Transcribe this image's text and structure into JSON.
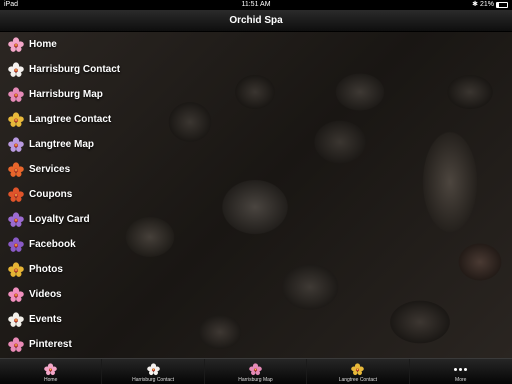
{
  "status_bar": {
    "device": "iPad",
    "time": "11:51 AM",
    "battery": "21%",
    "battery_level": 0.21
  },
  "nav": {
    "title": "Orchid Spa"
  },
  "menu": [
    {
      "label": "Home",
      "icon": "pink-orchid-icon",
      "color": "#f3a6c8"
    },
    {
      "label": "Harrisburg Contact",
      "icon": "white-orchid-icon",
      "color": "#f4f1ee"
    },
    {
      "label": "Harrisburg Map",
      "icon": "pink-orchid-icon",
      "color": "#e58ab7"
    },
    {
      "label": "Langtree Contact",
      "icon": "yellow-orchid-icon",
      "color": "#e8b93a"
    },
    {
      "label": "Langtree Map",
      "icon": "lavender-orchid-icon",
      "color": "#b99ae0"
    },
    {
      "label": "Services",
      "icon": "orange-orchid-icon",
      "color": "#e8662b"
    },
    {
      "label": "Coupons",
      "icon": "orange-red-orchid-icon",
      "color": "#e0542a"
    },
    {
      "label": "Loyalty Card",
      "icon": "purple-orchid-icon",
      "color": "#9b6bd0"
    },
    {
      "label": "Facebook",
      "icon": "purple-orchid-icon",
      "color": "#8a5ac6"
    },
    {
      "label": "Photos",
      "icon": "yellow-orchid-icon",
      "color": "#e6b434"
    },
    {
      "label": "Videos",
      "icon": "pink-orchid-icon",
      "color": "#f08fbd"
    },
    {
      "label": "Events",
      "icon": "white-orchid-icon",
      "color": "#f2efe9"
    },
    {
      "label": "Pinterest",
      "icon": "pink-orchid-icon",
      "color": "#e98ab6"
    }
  ],
  "tabs": [
    {
      "label": "Home",
      "icon": "pink-orchid-icon",
      "color": "#f3a6c8"
    },
    {
      "label": "Harrisburg Contact",
      "icon": "white-orchid-icon",
      "color": "#f4f1ee"
    },
    {
      "label": "Harrisburg Map",
      "icon": "pink-orchid-icon",
      "color": "#e58ab7"
    },
    {
      "label": "Langtree Contact",
      "icon": "yellow-orchid-icon",
      "color": "#e8b93a"
    },
    {
      "label": "More",
      "icon": "more-dots-icon"
    }
  ]
}
